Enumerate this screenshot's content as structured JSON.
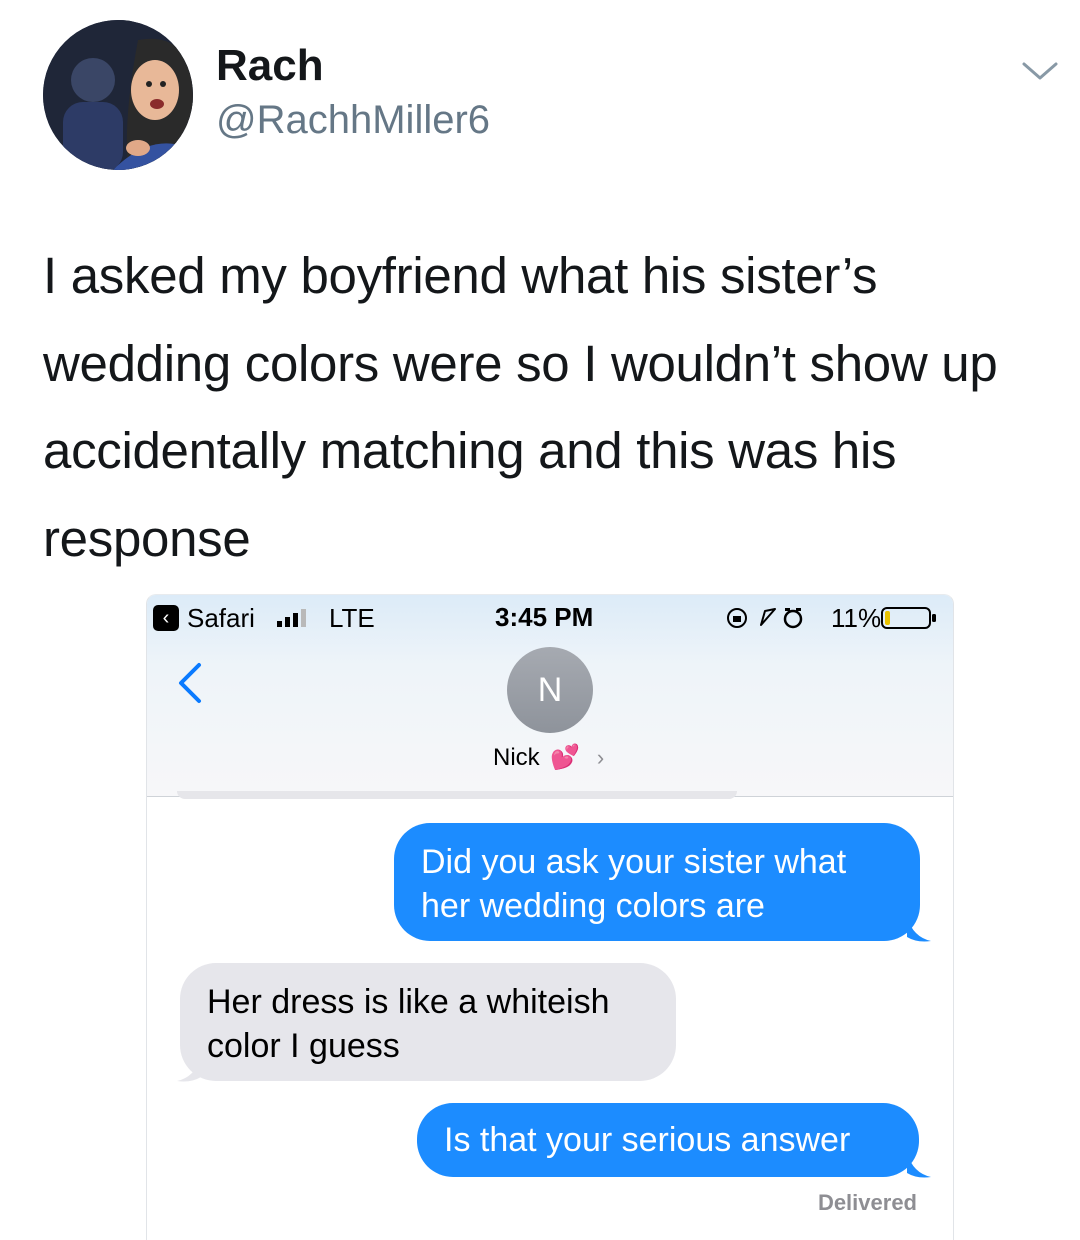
{
  "tweet": {
    "display_name": "Rach",
    "handle": "@RachhMiller6",
    "text": "I asked my boyfriend what his sister’s wedding colors were so I wouldn’t show up accidentally matching and this was his response"
  },
  "phone": {
    "status_bar": {
      "back_app": "Safari",
      "network": "LTE",
      "time": "3:45 PM",
      "battery_percent": "11%"
    },
    "contact": {
      "initial": "N",
      "name": "Nick",
      "emoji": "💕",
      "chevron": "›"
    },
    "messages": [
      {
        "direction": "outgoing",
        "text": "Did you ask your sister what\nher wedding colors are"
      },
      {
        "direction": "incoming",
        "text": "Her dress is like a whiteish\ncolor I guess"
      },
      {
        "direction": "outgoing",
        "text": "Is that your serious answer"
      }
    ],
    "delivery_status": "Delivered"
  },
  "colors": {
    "imessage_blue": "#1c8cff",
    "incoming_gray": "#e6e6eb",
    "twitter_secondary": "#657786",
    "ios_link_blue": "#0a7aff"
  }
}
